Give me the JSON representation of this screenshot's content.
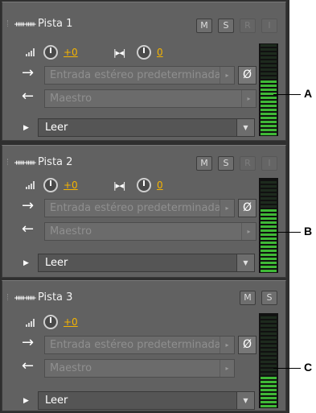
{
  "tracks": [
    {
      "name": "Pista 1",
      "mute_label": "M",
      "solo_label": "S",
      "rec_label": "R",
      "input_monitor_label": "I",
      "volume": "+0",
      "pan": "0",
      "input": "Entrada estéreo predeterminada",
      "output": "Maestro",
      "automation_mode": "Leer",
      "meter_level": 0.62
    },
    {
      "name": "Pista 2",
      "mute_label": "M",
      "solo_label": "S",
      "rec_label": "R",
      "input_monitor_label": "I",
      "volume": "+0",
      "pan": "0",
      "input": "Entrada estéreo predeterminada",
      "output": "Maestro",
      "automation_mode": "Leer",
      "meter_level": 0.68
    },
    {
      "name": "Pista 3",
      "mute_label": "M",
      "solo_label": "S",
      "volume": "+0",
      "input": "Entrada estéreo predeterminada",
      "output": "Maestro",
      "automation_mode": "Leer",
      "meter_level": 0.36
    }
  ],
  "callouts": [
    "A",
    "B",
    "C"
  ],
  "icons": {
    "track_type": "waveform-icon",
    "volume": "volume-icon",
    "pan": "pan-icon",
    "input": "input-arrow-icon",
    "output": "output-arrow-icon",
    "phase": "phase-invert-icon",
    "expand": "expand-triangle-icon",
    "dropdown": "dropdown-arrow-icon"
  },
  "colors": {
    "panel_bg": "#2f2f2f",
    "track_bg": "#616161",
    "value_accent": "#f5b400",
    "meter_green": "#3fb936",
    "meter_yellow": "#e8d85a",
    "meter_orange": "#e89a2a"
  }
}
